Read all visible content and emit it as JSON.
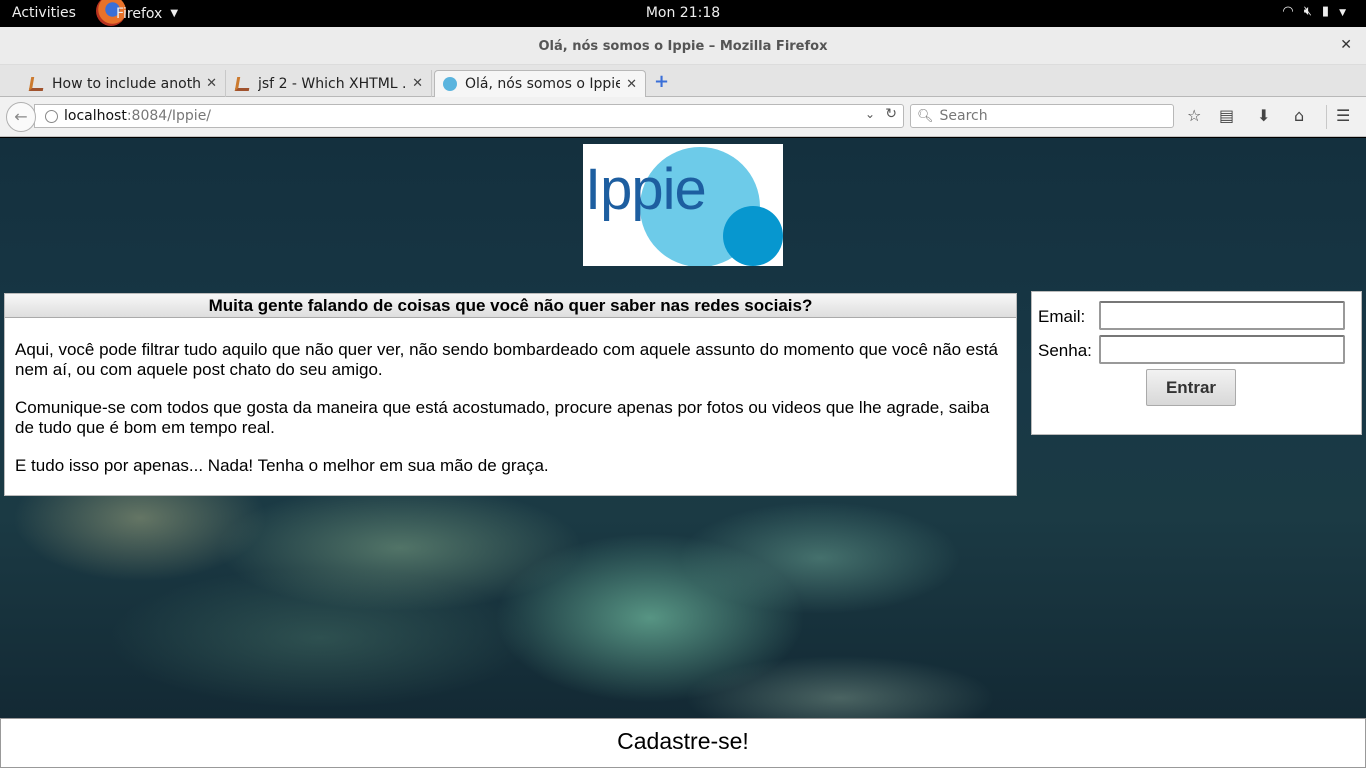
{
  "topbar": {
    "activities": "Activities",
    "app_name": "Firefox",
    "clock": "Mon 21:18"
  },
  "window": {
    "title": "Olá, nós somos o Ippie – Mozilla Firefox"
  },
  "tabs": [
    {
      "label": "How to include anoth...",
      "active": false
    },
    {
      "label": "jsf 2 - Which XHTML ...",
      "active": false
    },
    {
      "label": "Olá, nós somos o Ippie",
      "active": true
    }
  ],
  "navbar": {
    "url_host": "localhost",
    "url_rest": ":8084/Ippie/",
    "search_placeholder": "Search"
  },
  "page": {
    "logo_text": "Ippie",
    "info_heading": "Muita gente falando de coisas que você não quer saber nas redes sociais?",
    "paragraphs": [
      "Aqui, você pode filtrar tudo aquilo que não quer ver, não sendo bombardeado com aquele assunto do momento que você não está nem aí, ou com aquele post chato do seu amigo.",
      "Comunique-se com todos que gosta da maneira que está acostumado, procure apenas por fotos ou videos que lhe agrade, saiba de tudo que é bom em tempo real.",
      "E tudo isso por apenas... Nada! Tenha o melhor em sua mão de graça."
    ],
    "login": {
      "email_label": "Email:",
      "email_value": "",
      "password_label": "Senha:",
      "password_value": "",
      "submit_label": "Entrar"
    },
    "signup_label": "Cadastre-se!"
  },
  "colors": {
    "logo_blue_text": "#1d5ea0",
    "logo_light_circle": "#6dcbe9",
    "logo_dark_circle": "#0797cf"
  }
}
